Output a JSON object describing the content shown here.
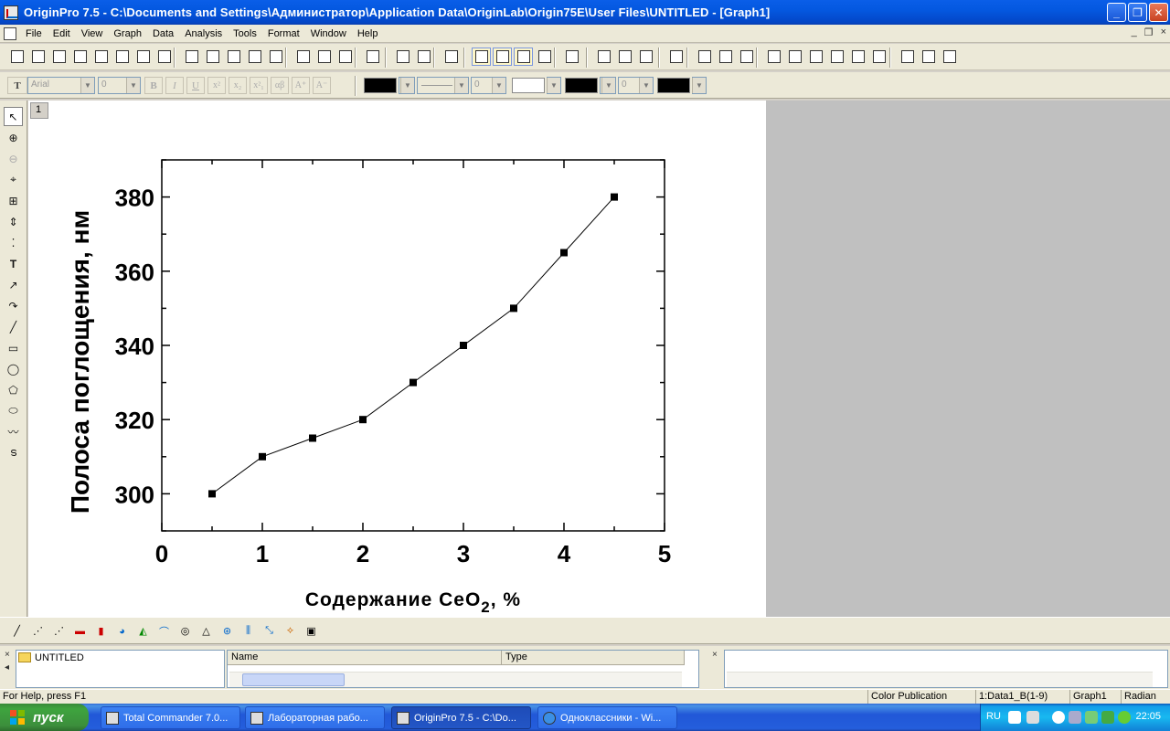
{
  "window": {
    "title": "OriginPro 7.5 - C:\\Documents and Settings\\Администратор\\Application Data\\OriginLab\\Origin75E\\User Files\\UNTITLED - [Graph1]",
    "buttons": {
      "minimize": "_",
      "restore": "❐",
      "close": "✕"
    }
  },
  "menu": [
    "File",
    "Edit",
    "View",
    "Graph",
    "Data",
    "Analysis",
    "Tools",
    "Format",
    "Window",
    "Help"
  ],
  "mdi_controls": {
    "minimize": "_",
    "restore": "❐",
    "close": "×"
  },
  "format_toolbar": {
    "font_name": "Arial",
    "font_size": "0",
    "bold": "B",
    "italic": "I",
    "underline": "U",
    "superscript": "x²",
    "subscript": "x₂",
    "supsub": "x²₁",
    "greek": "αβ",
    "increase": "A⁺",
    "decrease": "A⁻",
    "line_width": "0",
    "fill_size": "0",
    "colors": {
      "line": "#000000",
      "fill": "#000000",
      "font": "#000000"
    }
  },
  "graph": {
    "layer_label": "1"
  },
  "chart_data": {
    "type": "line",
    "xlabel": "Содержание CeO",
    "xlabel_subscript": "2",
    "xlabel_suffix": ", %",
    "ylabel": "Полоса поглощения, нм",
    "xlim": [
      0,
      5
    ],
    "ylim": [
      290,
      390
    ],
    "xticks": [
      0,
      1,
      2,
      3,
      4,
      5
    ],
    "yticks": [
      300,
      320,
      340,
      360,
      380
    ],
    "grid": false,
    "series": [
      {
        "x": [
          0.5,
          1.0,
          1.5,
          2.0,
          2.5,
          3.0,
          3.5,
          4.0,
          4.5
        ],
        "y": [
          300,
          310,
          315,
          320,
          330,
          340,
          350,
          365,
          380
        ],
        "marker": "square",
        "color": "#000000"
      }
    ]
  },
  "explorer": {
    "folder": "UNTITLED",
    "columns": [
      "Name",
      "Type"
    ]
  },
  "statusbar": {
    "help": "For Help, press F1",
    "mode": "Color Publication",
    "dataset": "1:Data1_B(1-9)",
    "window": "Graph1",
    "angle": "Radian"
  },
  "taskbar": {
    "start": "пуск",
    "tasks": [
      "Total Commander 7.0...",
      "Лабораторная рабо...",
      "OriginPro 7.5 - C:\\Do...",
      "Одноклассники - Wi..."
    ],
    "lang": "RU",
    "clock": "22:05"
  }
}
